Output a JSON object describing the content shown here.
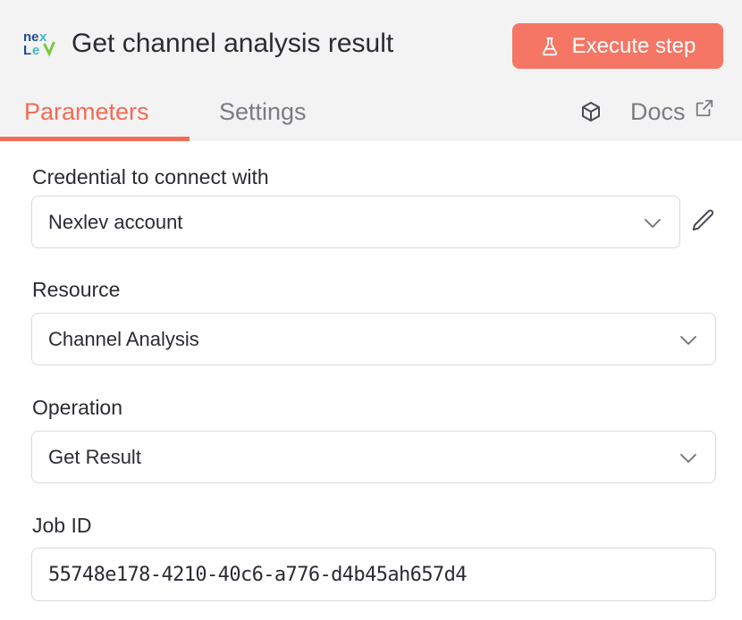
{
  "header": {
    "title": "Get channel analysis result",
    "execute_label": "Execute step",
    "logo_text": "nexlev"
  },
  "tabs": {
    "parameters": "Parameters",
    "settings": "Settings",
    "docs": "Docs"
  },
  "colors": {
    "accent": "#f26b57",
    "button": "#f57664",
    "header_bg": "#f3f3f3"
  },
  "form": {
    "credential": {
      "label": "Credential to connect with",
      "value": "Nexlev account"
    },
    "resource": {
      "label": "Resource",
      "value": "Channel Analysis"
    },
    "operation": {
      "label": "Operation",
      "value": "Get Result"
    },
    "job_id": {
      "label": "Job ID",
      "value": "55748e178-4210-40c6-a776-d4b45ah657d4"
    }
  }
}
